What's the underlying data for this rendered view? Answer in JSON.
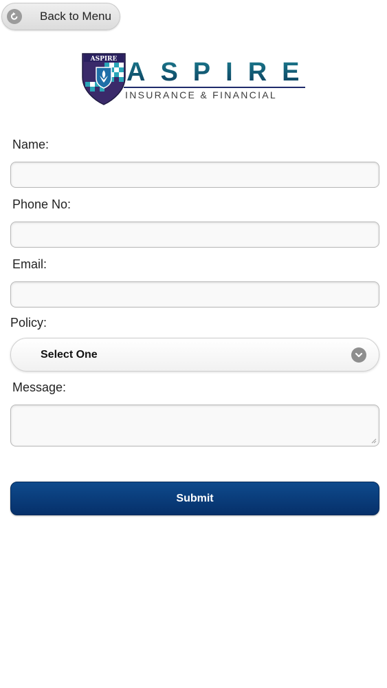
{
  "header": {
    "back_label": "Back to Menu",
    "back_icon": "back-arrow-icon"
  },
  "logo": {
    "emblem_text": "ASPIRE",
    "wordmark": "ASPIRE",
    "tagline": "INSURANCE & FINANCIAL",
    "colors": {
      "teal": "#1c7c8f",
      "navy": "#1e2a6a",
      "purple": "#3a2a6a"
    }
  },
  "form": {
    "name_label": "Name:",
    "name_value": "",
    "phone_label": "Phone No:",
    "phone_value": "",
    "email_label": "Email:",
    "email_value": "",
    "policy_label": "Policy:",
    "policy_selected": "Select One",
    "policy_icon": "chevron-down-icon",
    "message_label": "Message:",
    "message_value": "",
    "submit_label": "Submit"
  },
  "colors": {
    "submit_bg": "#0a3f7a",
    "input_border": "#b8b8b8"
  }
}
